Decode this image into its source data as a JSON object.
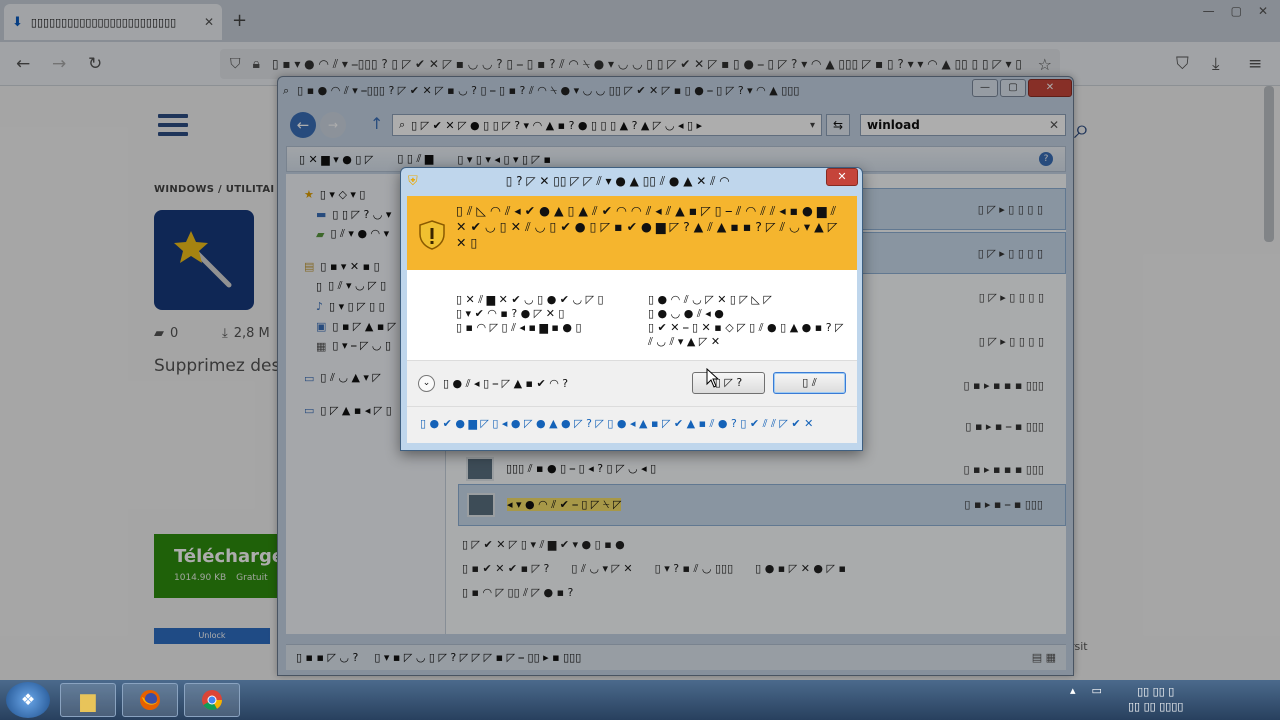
{
  "browser": {
    "tab_title": "▯▯▯▯▯▯▯▯▯▯▯▯▯▯▯▯▯▯▯▯▯▯▯▯",
    "url": "▯ ▪ ▾ ● ◠ ⫽ ▾ ⎯▯▯▯ ? ▯ ◸ ✔ ✕ ◸ ▪ ◡ ◡ ? ▯ ⎯ ▯ ▪ ? ⫽ ◠ ⍀ ● ▾ ◡ ◡ ▯ ▯ ◸ ✔ ✕ ◸ ▪ ▯ ● ⎯ ▯ ◸ ? ▾ ◠ ▲ ▯▯▯ ◸ ▪ ▯ ? ▾ ▾ ◠ ▲ ▯▯ ▯ ▯ ◸ ▾ ▯ ▯ ▯ ⎯ ▯▯▯"
  },
  "site": {
    "breadcrumb": "WINDOWS  /  UTILITAI",
    "comments_count": "0",
    "downloads_count": "2,8 M",
    "summary": "Supprimez des",
    "download_button": "Télécharge",
    "file_size": "1014.90 KB",
    "license": "Gratuit",
    "ad_label": "Unlock",
    "side_credit": "rsit"
  },
  "explorer": {
    "title": "▯ ▪ ● ◠ ⫽ ▾ ⎯▯▯▯ ? ◸ ✔ ✕ ◸ ▪ ◡ ? ▯ ⎯ ▯ ▪ ? ⫽ ◠ ⍀ ● ▾ ◡ ◡ ▯▯ ◸ ✔ ✕ ◸ ▪ ▯ ● ⎯ ▯ ◸ ? ▾ ◠ ▲ ▯▯▯",
    "address": "▯ ◸ ✔ ✕ ◸ ● ▯ ▯ ◸ ? ▾ ◠ ▲ ▪ ? ● ▯ ▯ ▯ ▲ ? ▲ ◸ ◡ ◂ ▯ ▸",
    "search_value": "winload",
    "toolbar_organize": "▯ ✕ ▆ ▾ ● ▯ ◸",
    "toolbar_save_search": "▯ ▯ ⫽ ▆",
    "toolbar_burn": "▯ ▾ ▯ ▾ ◂ ▯ ▾ ▯ ◸ ▪",
    "nav_favorites": "▯ ▾ ◇ ▾ ▯",
    "nav_desktop": "▯ ▯ ◸ ? ◡ ▾",
    "nav_downloads": "▯ ⫽ ▾ ● ◠ ▾",
    "nav_libraries": "▯ ▪ ▾ ✕ ▪ ▯",
    "nav_docs": "▯ ⫽ ▾ ◡ ◸ ▯",
    "nav_music": "▯ ▾ ▯ ◸ ▯ ▯",
    "nav_pictures": "▯ ▪ ◸ ▲ ▪ ◸",
    "nav_videos": "▯ ▾ ⎯ ◸ ◡ ▯",
    "nav_computer": "▯ ⫽ ◡ ▲ ▾ ◸",
    "nav_network": "▯ ◸ ▲ ▪ ◂ ◸ ▯",
    "row_kind_a": "▯ ◸ ▸ ▯ ▯ ▯ ▯",
    "row_kind_b": "▯ ▪ ▸ ▪ ▪ ▪ ▯▯▯",
    "row_kind_c": "▯ ▪ ▸ ▪ ⎯ ▪ ▯▯▯",
    "row_name_plain": "▯▯▯ ⫽ ▪ ● ▯ ⎯ ▯ ◂ ? ▯ ◸ ◡ ◂ ▯",
    "row_name_hl": "◂ ▾ ● ◠ ⫽ ✔ ⎯ ▯ ◸ ⍀ ◸",
    "details_line1": "▯ ◸ ✔ ✕ ◸ ▯ ▾ ⫽ ▆ ✔ ▾ ● ▯ ▪ ●",
    "details_a": "▯ ▪ ✔ ✕ ✔ ▪ ◸ ?",
    "details_b": "▯ ⫽ ◡ ▾ ◸ ✕",
    "details_c": "▯ ▾ ? ▪ ⫽ ◡ ▯▯▯",
    "details_d": "▯ ● ▪ ◸ ✕ ● ◸ ▪",
    "details_line3": "▯ ▪ ◠ ◸ ▯▯ ⫽ ◸ ● ▪ ?",
    "status_count": "▯ ▪ ▪ ◸ ◡ ?",
    "status_search": "▯ ▾ ▪ ◸ ◡ ▯ ◸ ? ◸ ◸ ◸ ▪ ◸ ⎯ ▯▯ ▸ ▪ ▯▯▯"
  },
  "dialog": {
    "title": "▯ ? ◸ ✕ ▯▯ ◸ ◸ ⫽ ▾ ● ▲ ▯▯ ⫽ ● ▲ ✕ ⫽ ◠",
    "close_label": "✕",
    "banner_text": "▯ ⫽ ◺ ◠ ⫽ ◂ ✔ ● ▲ ▯ ▲ ⫽ ✔ ◠ ◠ ⫽ ◂ ⫽ ▲ ▪ ◸ ▯ ⎯ ⫽ ◠ ⫽ ⫽ ◂ ▪ ● ▆ ⫽ ✕ ✔ ◡ ▯ ✕ ⫽ ◡ ▯ ✔ ● ▯ ◸ ▪ ✔ ● ▆ ◸ ? ▲ ⫽ ▲ ▪ ▪ ? ◸ ⫽ ◡ ▾ ▲ ◸ ✕ ▯",
    "label_program": "▯ ✕ ⫽ ▆ ✕ ✔ ◡ ▯ ● ✔ ◡ ◸ ▯",
    "label_publisher": "▯ ▾ ✔ ◠ ▪ ? ● ◸ ✕ ▯",
    "label_origin": "▯ ▪ ◠ ◸ ▯ ⫽ ◂ ▪ ▆ ▪ ● ▯",
    "value_program": "▯ ● ◠ ⫽ ◡ ◸ ✕ ▯ ◸ ◺ ◸",
    "value_publisher": "▯ ● ◡ ● ⫽ ◂ ●",
    "value_origin": "▯ ✔ ✕ ⎯ ▯ ✕ ▪ ◇ ◸ ▯ ⫽ ● ▯ ▲ ● ▪ ? ◸ ⫽ ◡ ⫽ ▾ ▲ ◸ ✕",
    "show_details": "▯ ● ⫽ ◂ ▯ ⎯ ◸ ▲ ▪ ✔ ◠ ?",
    "btn_yes": "▯ ◸ ?",
    "btn_no": "▯ ⫽",
    "change_link": "▯ ● ✔ ● ▆ ◸ ▯ ◂ ● ◸ ● ▲ ● ◸ ? ◸ ▯ ● ◂ ▲ ▪ ◸ ✔ ▲ ▪ ⫽ ● ? ▯ ✔ ⫽ ⫽ ◸ ✔ ✕"
  },
  "taskbar": {
    "clock_time": "▯▯ ▯▯ ▯",
    "clock_date": "▯▯ ▯▯ ▯▯▯▯"
  }
}
